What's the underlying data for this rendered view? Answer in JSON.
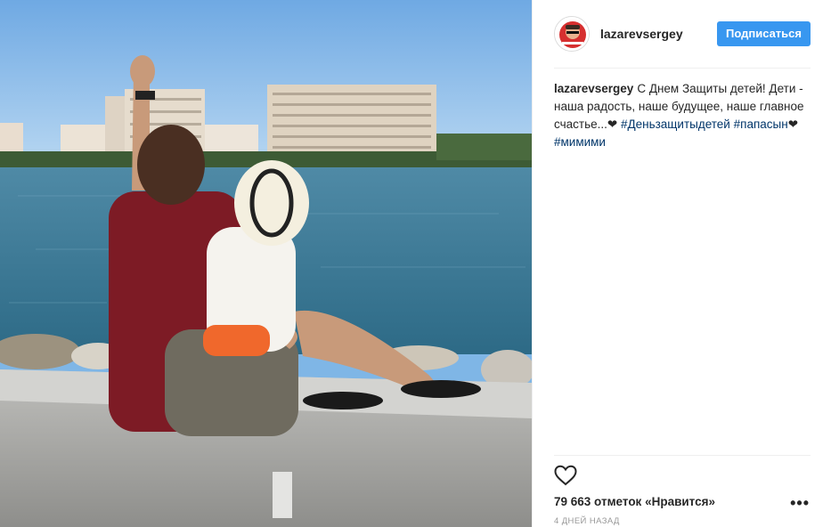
{
  "post": {
    "username": "lazarevsergey",
    "follow_label": "Подписаться",
    "caption_user": "lazarevsergey",
    "caption_text": "С Днем Защиты детей! Дети - наша радость, наше будущее, наше главное счастье...",
    "caption_heart": "❤",
    "hashtags": [
      "#Деньзащитыдетей",
      "#папасын",
      "#мимими"
    ],
    "hashtag_heart": "❤",
    "likes_text": "79 663 отметок «Нравится»",
    "timestamp": "4 дней назад",
    "more_icon": "•••"
  },
  "colors": {
    "accent": "#3897f0",
    "hashtag": "#003569",
    "text": "#262626",
    "muted": "#999999",
    "sky": "#8ec0ec",
    "water": "#3f7a95"
  },
  "icons": {
    "like": "heart-outline-icon",
    "more": "ellipsis-icon"
  }
}
